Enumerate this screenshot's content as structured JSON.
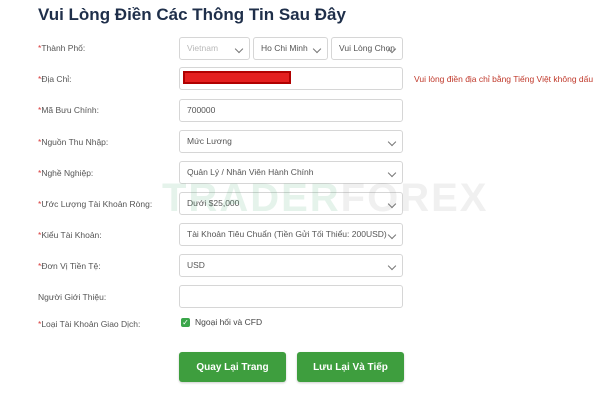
{
  "page_title": "Vui Lòng Điền Các Thông Tin Sau Đây",
  "labels": {
    "city": "Thành Phố:",
    "address": "Địa Chỉ:",
    "postal": "Mã Bưu Chính:",
    "income_source": "Nguồn Thu Nhập:",
    "occupation": "Nghề Nghiệp:",
    "net_worth": "Ước Lượng Tài Khoản Ròng:",
    "account_type": "Kiểu Tài Khoản:",
    "currency": "Đơn Vị Tiền Tệ:",
    "referrer": "Người Giới Thiệu:",
    "trading_type": "Loại Tài Khoản Giao Dịch:"
  },
  "required_mark": "*",
  "fields": {
    "country": "Vietnam",
    "province": "Ho Chi Minh",
    "district": "Vui Lòng Chọn",
    "postal": "700000",
    "income_source": "Mức Lương",
    "occupation": "Quản Lý / Nhân Viên Hành Chính",
    "net_worth": "Dưới $25,000",
    "account_type": "Tài Khoản Tiêu Chuẩn (Tiền Gửi Tối Thiểu: 200USD)",
    "currency": "USD",
    "referrer": ""
  },
  "address_error": "Vui lòng điền địa chỉ bằng Tiếng Việt không dấu",
  "checkbox_label": "Ngoại hối và CFD",
  "watermark": {
    "part1": "TRADER",
    "part2": "FOREX"
  },
  "buttons": {
    "back": "Quay Lại Trang Trước",
    "save": "Lưu Lại Và Tiếp Tục"
  },
  "colors": {
    "accent_green": "#3e9e3e",
    "error_red": "#c0392b",
    "required_red": "#d93a3a"
  }
}
